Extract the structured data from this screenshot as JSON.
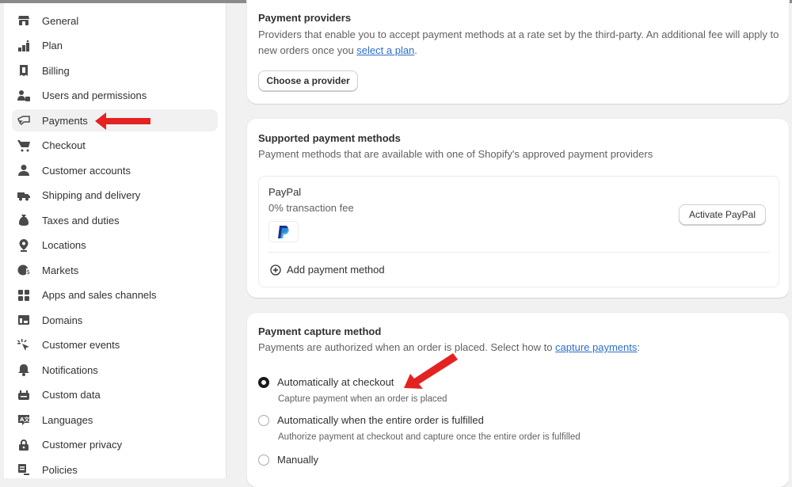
{
  "sidebar": {
    "items": [
      {
        "label": "General",
        "icon": "store-icon"
      },
      {
        "label": "Plan",
        "icon": "plan-icon"
      },
      {
        "label": "Billing",
        "icon": "billing-icon"
      },
      {
        "label": "Users and permissions",
        "icon": "users-icon"
      },
      {
        "label": "Payments",
        "icon": "payments-icon",
        "active": true
      },
      {
        "label": "Checkout",
        "icon": "cart-icon"
      },
      {
        "label": "Customer accounts",
        "icon": "person-icon"
      },
      {
        "label": "Shipping and delivery",
        "icon": "truck-icon"
      },
      {
        "label": "Taxes and duties",
        "icon": "tax-bag-icon"
      },
      {
        "label": "Locations",
        "icon": "location-pin-icon"
      },
      {
        "label": "Markets",
        "icon": "globe-icon"
      },
      {
        "label": "Apps and sales channels",
        "icon": "apps-icon"
      },
      {
        "label": "Domains",
        "icon": "domains-icon"
      },
      {
        "label": "Customer events",
        "icon": "cursor-click-icon"
      },
      {
        "label": "Notifications",
        "icon": "bell-icon"
      },
      {
        "label": "Custom data",
        "icon": "custom-data-icon"
      },
      {
        "label": "Languages",
        "icon": "language-icon"
      },
      {
        "label": "Customer privacy",
        "icon": "lock-icon"
      },
      {
        "label": "Policies",
        "icon": "policies-icon"
      }
    ]
  },
  "payment_providers": {
    "title": "Payment providers",
    "description_before_link": "Providers that enable you to accept payment methods at a rate set by the third-party. An additional fee will apply to new orders once you ",
    "link": "select a plan",
    "description_after_link": ".",
    "button": "Choose a provider"
  },
  "supported_methods": {
    "title": "Supported payment methods",
    "description": "Payment methods that are available with one of Shopify's approved payment providers",
    "provider_name": "PayPal",
    "provider_fee": "0% transaction fee",
    "activate_button": "Activate PayPal",
    "add_method": "Add payment method"
  },
  "capture_method": {
    "title": "Payment capture method",
    "description_before_link": "Payments are authorized when an order is placed. Select how to ",
    "link": "capture payments",
    "description_after_link": ":",
    "options": [
      {
        "label": "Automatically at checkout",
        "help": "Capture payment when an order is placed",
        "checked": true
      },
      {
        "label": "Automatically when the entire order is fulfilled",
        "help": "Authorize payment at checkout and capture once the entire order is fulfilled",
        "checked": false
      },
      {
        "label": "Manually",
        "help": "",
        "checked": false
      }
    ]
  },
  "colors": {
    "link": "#2c6ecb",
    "annotation_arrow": "#e52222",
    "paypal_dark": "#1b2f8f",
    "paypal_light": "#2a9be0"
  }
}
